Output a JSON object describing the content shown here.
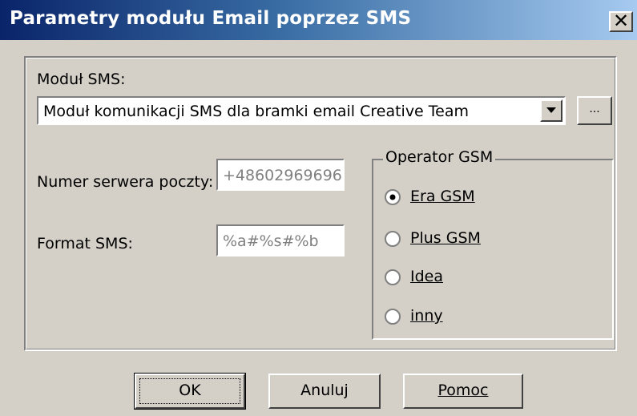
{
  "window": {
    "title": "Parametry modułu Email poprzez SMS",
    "close_symbol": "✕"
  },
  "sms_module": {
    "label": "Moduł SMS:",
    "selected": "Moduł komunikacji SMS dla bramki email Creative Team",
    "browse_label": "..."
  },
  "server_number": {
    "label": "Numer serwera poczty:",
    "value": "+48602969696"
  },
  "sms_format": {
    "label": "Format SMS:",
    "value": "%a#%s#%b"
  },
  "operator": {
    "legend": "Operator GSM",
    "options": [
      {
        "label": "Era GSM",
        "checked": true
      },
      {
        "label": "Plus GSM",
        "checked": false
      },
      {
        "label": "Idea",
        "checked": false
      },
      {
        "label": "inny",
        "checked": false
      }
    ]
  },
  "buttons": {
    "ok": "OK",
    "cancel": "Anuluj",
    "help": "Pomoc"
  }
}
